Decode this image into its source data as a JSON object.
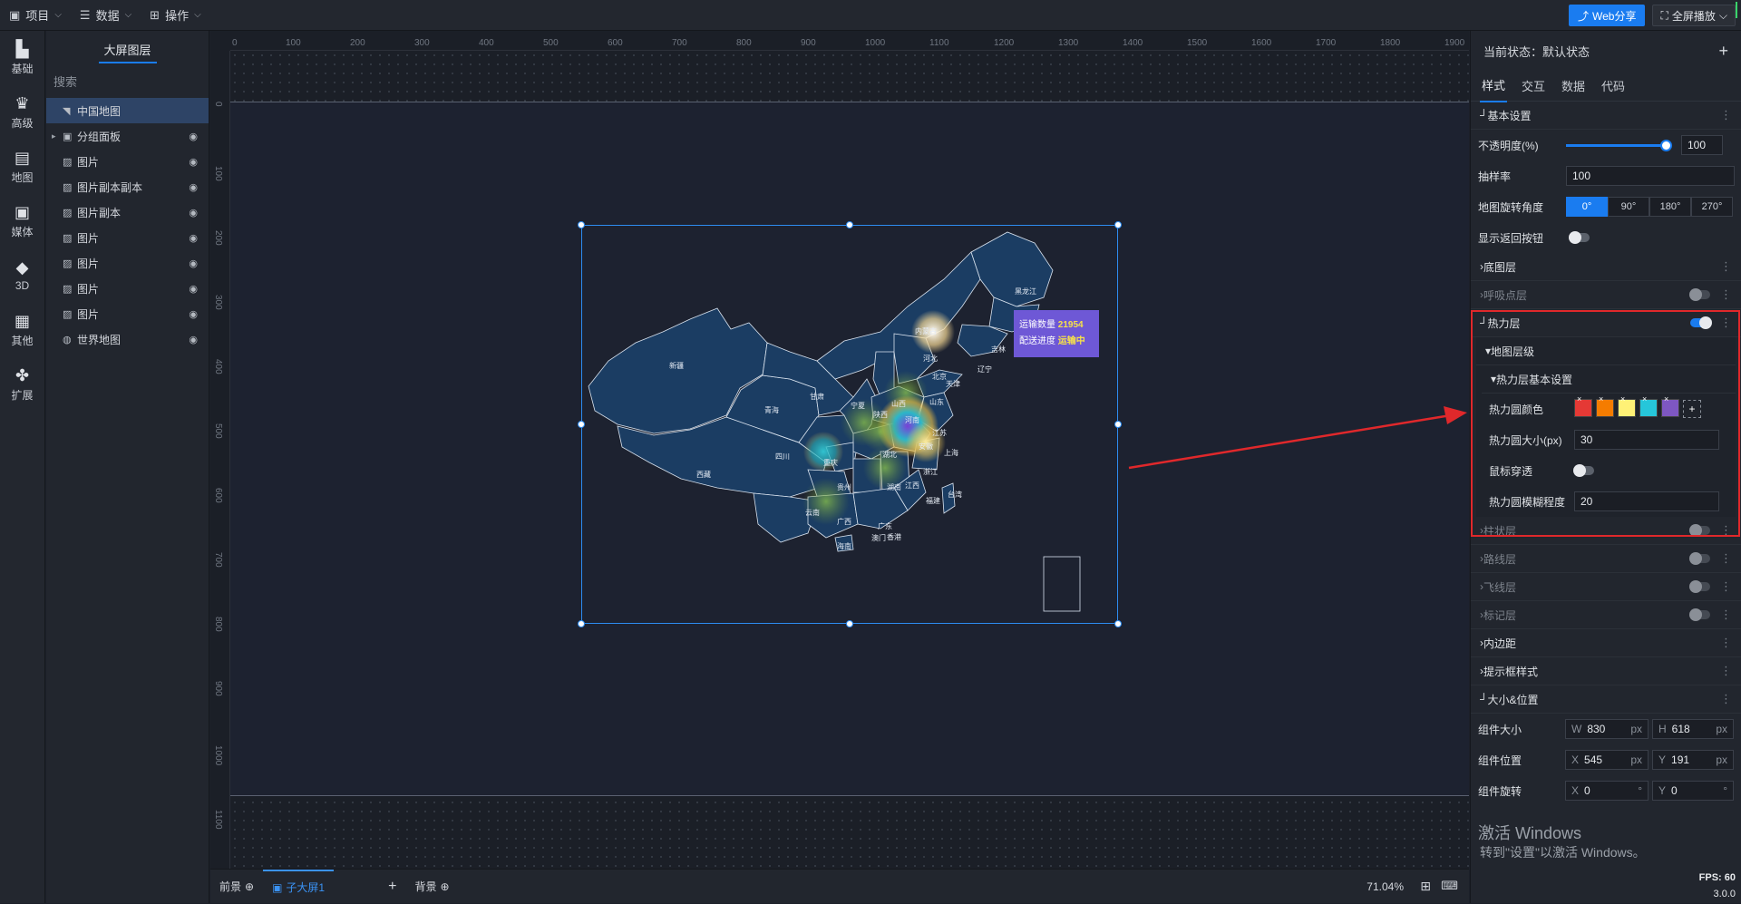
{
  "topbar": {
    "menus": [
      "项目",
      "数据",
      "操作"
    ],
    "share_label": "Web分享",
    "fullscreen_label": "全屏播放"
  },
  "leftnav": {
    "items": [
      {
        "label": "基础",
        "icon": "bar-chart-icon"
      },
      {
        "label": "高级",
        "icon": "crown-icon"
      },
      {
        "label": "地图",
        "icon": "map-icon"
      },
      {
        "label": "媒体",
        "icon": "media-icon"
      },
      {
        "label": "3D",
        "icon": "cube-icon"
      },
      {
        "label": "其他",
        "icon": "other-icon"
      },
      {
        "label": "扩展",
        "icon": "puzzle-icon"
      }
    ]
  },
  "layers": {
    "tab_label": "大屏图层",
    "search_placeholder": "搜索",
    "items": [
      {
        "label": "中国地图"
      },
      {
        "label": "分组面板"
      },
      {
        "label": "图片"
      },
      {
        "label": "图片副本副本"
      },
      {
        "label": "图片副本"
      },
      {
        "label": "图片"
      },
      {
        "label": "图片"
      },
      {
        "label": "图片"
      },
      {
        "label": "图片"
      },
      {
        "label": "世界地图"
      }
    ]
  },
  "ruler": {
    "x_ticks": [
      "0",
      "100",
      "200",
      "300",
      "400",
      "500",
      "600",
      "700",
      "800",
      "900",
      "1000",
      "1100",
      "1200",
      "1300",
      "1400",
      "1500",
      "1600",
      "1700",
      "1800",
      "1900"
    ],
    "y_ticks": [
      "0",
      "100",
      "200",
      "300",
      "400",
      "500",
      "600",
      "700",
      "800",
      "900",
      "1000",
      "1100"
    ]
  },
  "map": {
    "tooltip_line1_label": "运输数量",
    "tooltip_line1_value": "21954",
    "tooltip_line2_label": "配送进度",
    "tooltip_line2_value": "运输中",
    "provinces": [
      "黑龙江",
      "内蒙古",
      "新疆",
      "甘肃",
      "宁夏",
      "青海",
      "西藏",
      "四川",
      "陕西",
      "山西",
      "河北",
      "北京",
      "天津",
      "辽宁",
      "吉林",
      "山东",
      "河南",
      "江苏",
      "上海",
      "安徽",
      "湖北",
      "重庆",
      "贵州",
      "湖南",
      "江西",
      "浙江",
      "福建",
      "云南",
      "广西",
      "广东",
      "台湾",
      "澳门",
      "香港",
      "海南"
    ]
  },
  "bottombar": {
    "tabs": [
      "前景",
      "子大屏1",
      "背景"
    ],
    "zoom": "71.04%"
  },
  "panel": {
    "state_label": "当前状态：默认状态",
    "tabs": [
      "样式",
      "交互",
      "数据",
      "代码"
    ],
    "basic_title": "基本设置",
    "opacity_label": "不透明度(%)",
    "opacity_value": "100",
    "opacity_fraction": 1.0,
    "sampling_label": "抽样率",
    "sampling_value": "100",
    "rotation_label": "地图旋转角度",
    "rotation_options": [
      "0°",
      "90°",
      "180°",
      "270°"
    ],
    "back_button_label": "显示返回按钮",
    "sections_a": [
      "底图层",
      "呼吸点层"
    ],
    "heat_title": "热力层",
    "map_level": "地图层级",
    "heat_basic": "热力层基本设置",
    "heat_color_label": "热力圆颜色",
    "heat_colors": [
      "#e53935",
      "#f57c00",
      "#fff176",
      "#26c6da",
      "#7e57c2"
    ],
    "heat_size_label": "热力圆大小(px)",
    "heat_size_value": "30",
    "mouse_through_label": "鼠标穿透",
    "heat_blur_label": "热力圆模糊程度",
    "heat_blur_value": "20",
    "sections_b": [
      "柱状层",
      "路线层",
      "飞线层",
      "标记层"
    ],
    "sections_c": [
      "内边距",
      "提示框样式",
      "大小&位置"
    ],
    "size_label": "组件大小",
    "size_w": "830",
    "size_h": "618",
    "pos_label": "组件位置",
    "pos_x": "545",
    "pos_y": "191",
    "rot_label": "组件旋转",
    "rot_x": "0",
    "rot_y": "0",
    "watermark_line1": "激活 Windows",
    "watermark_line2": "转到\"设置\"以激活 Windows。",
    "fps": "FPS: 60",
    "version": "3.0.0"
  }
}
